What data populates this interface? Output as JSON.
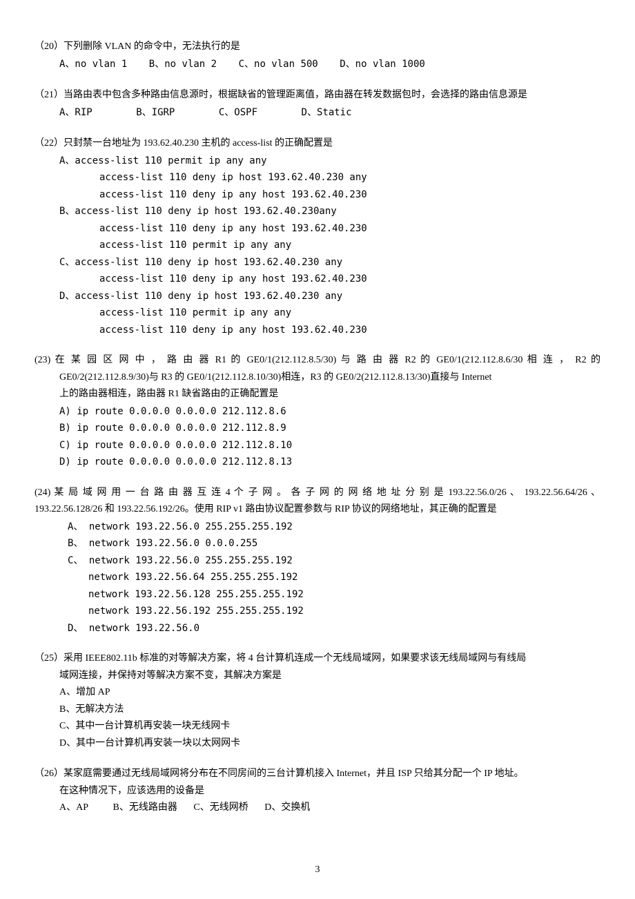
{
  "q20": {
    "stem": "（20）下列删除 VLAN 的命令中，无法执行的是",
    "opts": [
      "A、no vlan 1",
      "B、no vlan 2",
      "C、no vlan 500",
      "D、no vlan 1000"
    ]
  },
  "q21": {
    "stem": "（21）当路由表中包含多种路由信息源时，根据缺省的管理距离值，路由器在转发数据包时，会选择的路由信息源是",
    "opts": [
      "A、RIP",
      "B、IGRP",
      "C、OSPF",
      "D、Static"
    ]
  },
  "q22": {
    "stem": "（22）只封禁一台地址为 193.62.40.230 主机的 access-list 的正确配置是",
    "a_label": "A、access-list 110 permit ip any any",
    "a_l2": "access-list 110 deny ip host 193.62.40.230 any",
    "a_l3": "access-list 110 deny ip any host 193.62.40.230",
    "b_label": "B、access-list 110 deny ip host 193.62.40.230any",
    "b_l2": "access-list 110 deny ip any host 193.62.40.230",
    "b_l3": "access-list 110 permit ip any any",
    "c_label": "C、access-list 110 deny ip host 193.62.40.230 any",
    "c_l2": "access-list 110 deny ip any host 193.62.40.230",
    "d_label": "D、access-list 110 deny ip host 193.62.40.230 any",
    "d_l2": "access-list 110 permit ip any any",
    "d_l3": "access-list 110 deny ip any host 193.62.40.230"
  },
  "q23": {
    "stem1": "(23) 在 某 园 区 网 中 ， 路 由 器 R1 的 GE0/1(212.112.8.5/30) 与 路 由 器 R2 的 GE0/1(212.112.8.6/30 相 连 ， R2 的",
    "stem2": "GE0/2(212.112.8.9/30)与 R3 的 GE0/1(212.112.8.10/30)相连，R3 的 GE0/2(212.112.8.13/30)直接与 Internet",
    "stem3": "上的路由器相连，路由器 R1 缺省路由的正确配置是",
    "a": "A) ip route 0.0.0.0  0.0.0.0 212.112.8.6",
    "b": "B) ip route 0.0.0.0  0.0.0.0 212.112.8.9",
    "c": "C) ip route 0.0.0.0  0.0.0.0 212.112.8.10",
    "d": "D) ip route 0.0.0.0  0.0.0.0 212.112.8.13"
  },
  "q24": {
    "stem1": "(24) 某 局 域 网 用 一 台 路 由 器 互 连 4 个 子 网 。 各 子 网 的 网 络 地 址 分 别 是 193.22.56.0/26 、 193.22.56.64/26 、",
    "stem2": "193.22.56.128/26 和 193.22.56.192/26。使用 RIP v1 路由协议配置参数与 RIP 协议的网络地址，其正确的配置是",
    "a": "A、 network 193.22.56.0  255.255.255.192",
    "b": "B、 network 193.22.56.0  0.0.0.255",
    "c": "C、 network 193.22.56.0  255.255.255.192",
    "c2": "network 193.22.56.64  255.255.255.192",
    "c3": "network 193.22.56.128  255.255.255.192",
    "c4": "network 193.22.56.192  255.255.255.192",
    "d": "D、 network 193.22.56.0"
  },
  "q25": {
    "stem": "（25）采用 IEEE802.11b 标准的对等解决方案，将 4 台计算机连成一个无线局域网，如果要求该无线局域网与有线局",
    "stem2": "域网连接，并保持对等解决方案不变，其解决方案是",
    "a": "A、增加 AP",
    "b": "B、无解决方法",
    "c": "C、其中一台计算机再安装一块无线网卡",
    "d": "D、其中一台计算机再安装一块以太网网卡"
  },
  "q26": {
    "stem": "（26）某家庭需要通过无线局域网将分布在不同房间的三台计算机接入 Internet，并且 ISP 只给其分配一个 IP 地址。",
    "stem2": "在这种情况下，应该选用的设备是",
    "opts": [
      "A、AP",
      "B、无线路由器",
      "C、无线网桥",
      "D、交换机"
    ]
  },
  "page_number": "3"
}
